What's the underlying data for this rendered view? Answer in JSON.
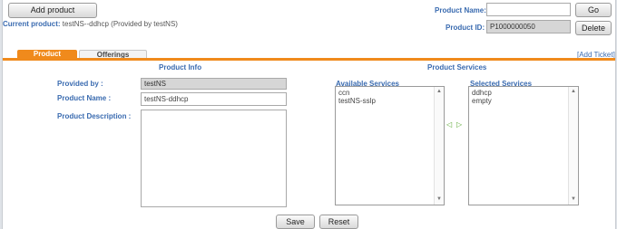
{
  "toolbar": {
    "add_product": "Add product",
    "product_name_label": "Product Name:",
    "product_name_value": "",
    "go": "Go",
    "product_id_label": "Product ID:",
    "product_id_value": "P1000000050",
    "delete": "Delete"
  },
  "current_product": {
    "label": "Current product:",
    "value": "testNS--ddhcp (Provided by testNS)"
  },
  "tabs": [
    {
      "label": "Product",
      "active": true
    },
    {
      "label": "Offerings",
      "active": false
    }
  ],
  "add_ticket": "[Add Ticket]",
  "product_info": {
    "title": "Product Info",
    "provided_by_label": "Provided by :",
    "provided_by_value": "testNS",
    "name_label": "Product Name :",
    "name_value": "testNS-ddhcp",
    "description_label": "Product Description :",
    "description_value": ""
  },
  "product_services": {
    "title": "Product Services",
    "available_label": "Available Services",
    "available_items": [
      "ccn",
      "testNS-sslp"
    ],
    "selected_label": "Selected Services",
    "selected_items": [
      "ddhcp",
      "empty"
    ],
    "move_left_icon": "triangle-left-icon",
    "move_right_icon": "triangle-right-icon"
  },
  "footer": {
    "save": "Save",
    "reset": "Reset"
  },
  "colors": {
    "accent_orange": "#f08a1c",
    "label_blue": "#3a6bb0"
  }
}
